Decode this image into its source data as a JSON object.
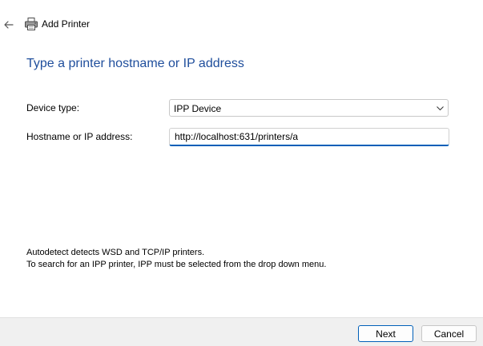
{
  "window": {
    "title": "Add Printer",
    "icons": {
      "back": "back-arrow-icon",
      "app": "printer-icon"
    }
  },
  "page": {
    "heading": "Type a printer hostname or IP address"
  },
  "form": {
    "device_type_label": "Device type:",
    "device_type_value": "IPP Device",
    "hostname_label": "Hostname or IP address:",
    "hostname_value": "http://localhost:631/printers/a"
  },
  "info": {
    "line1": "Autodetect detects WSD and TCP/IP printers.",
    "line2": "To search for an IPP printer, IPP must be selected from the drop down menu."
  },
  "buttons": {
    "next_label": "Next",
    "cancel_label": "Cancel"
  },
  "colors": {
    "heading": "#1f4e9c",
    "accent": "#005fb8",
    "footer_bg": "#f0f0f0"
  }
}
